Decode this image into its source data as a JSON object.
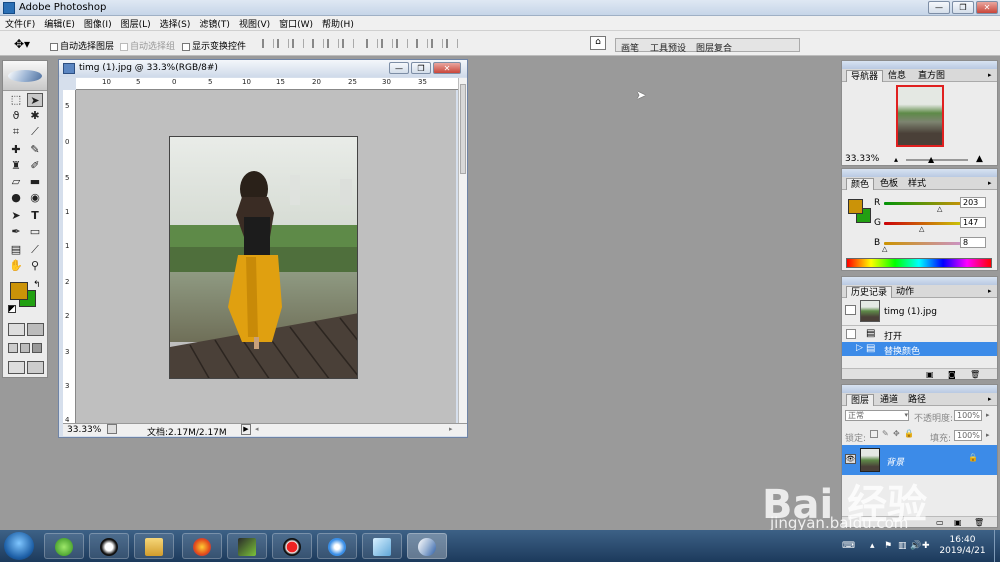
{
  "app": {
    "title": "Adobe Photoshop"
  },
  "window_controls": {
    "minimize": "—",
    "restore": "❐",
    "close": "✕"
  },
  "menu": [
    "文件(F)",
    "编辑(E)",
    "图像(I)",
    "图层(L)",
    "选择(S)",
    "滤镜(T)",
    "视图(V)",
    "窗口(W)",
    "帮助(H)"
  ],
  "options": {
    "auto_select_layer": "自动选择图层",
    "auto_select_group": "自动选择组",
    "show_transform": "显示变换控件"
  },
  "palette_well": [
    "画笔",
    "工具预设",
    "图层复合"
  ],
  "document": {
    "title": "timg (1).jpg @ 33.3%(RGB/8#)",
    "zoom": "33.33%",
    "doc_info": "文档:2.17M/2.17M",
    "ruler_top": [
      "10",
      "5",
      "0",
      "5",
      "10",
      "15",
      "20",
      "25",
      "30",
      "35"
    ],
    "ruler_left": [
      "5",
      "0",
      "5",
      "1",
      "1",
      "2",
      "2",
      "3",
      "3",
      "4"
    ]
  },
  "colors": {
    "foreground": "#cb9308",
    "background": "#22a012",
    "selection": "#3c8be8"
  },
  "navigator": {
    "tabs": [
      "导航器",
      "信息",
      "直方图"
    ],
    "zoom": "33.33%"
  },
  "color_panel": {
    "tabs": [
      "颜色",
      "色板",
      "样式"
    ],
    "r_label": "R",
    "g_label": "G",
    "b_label": "B",
    "r": "203",
    "g": "147",
    "b": "8"
  },
  "history": {
    "tabs": [
      "历史记录",
      "动作"
    ],
    "snapshot": "timg (1).jpg",
    "items": [
      "打开",
      "替换颜色"
    ]
  },
  "layers": {
    "tabs": [
      "图层",
      "通道",
      "路径"
    ],
    "blend_mode": "正常",
    "opacity_label": "不透明度:",
    "opacity": "100%",
    "lock_label": "锁定:",
    "fill_label": "填充:",
    "fill": "100%",
    "layer_name": "背景"
  },
  "taskbar": {
    "time": "16:40",
    "date": "2019/4/21"
  },
  "watermark": {
    "logo": "Bai  经验",
    "url": "jingyan.baidu.com"
  }
}
